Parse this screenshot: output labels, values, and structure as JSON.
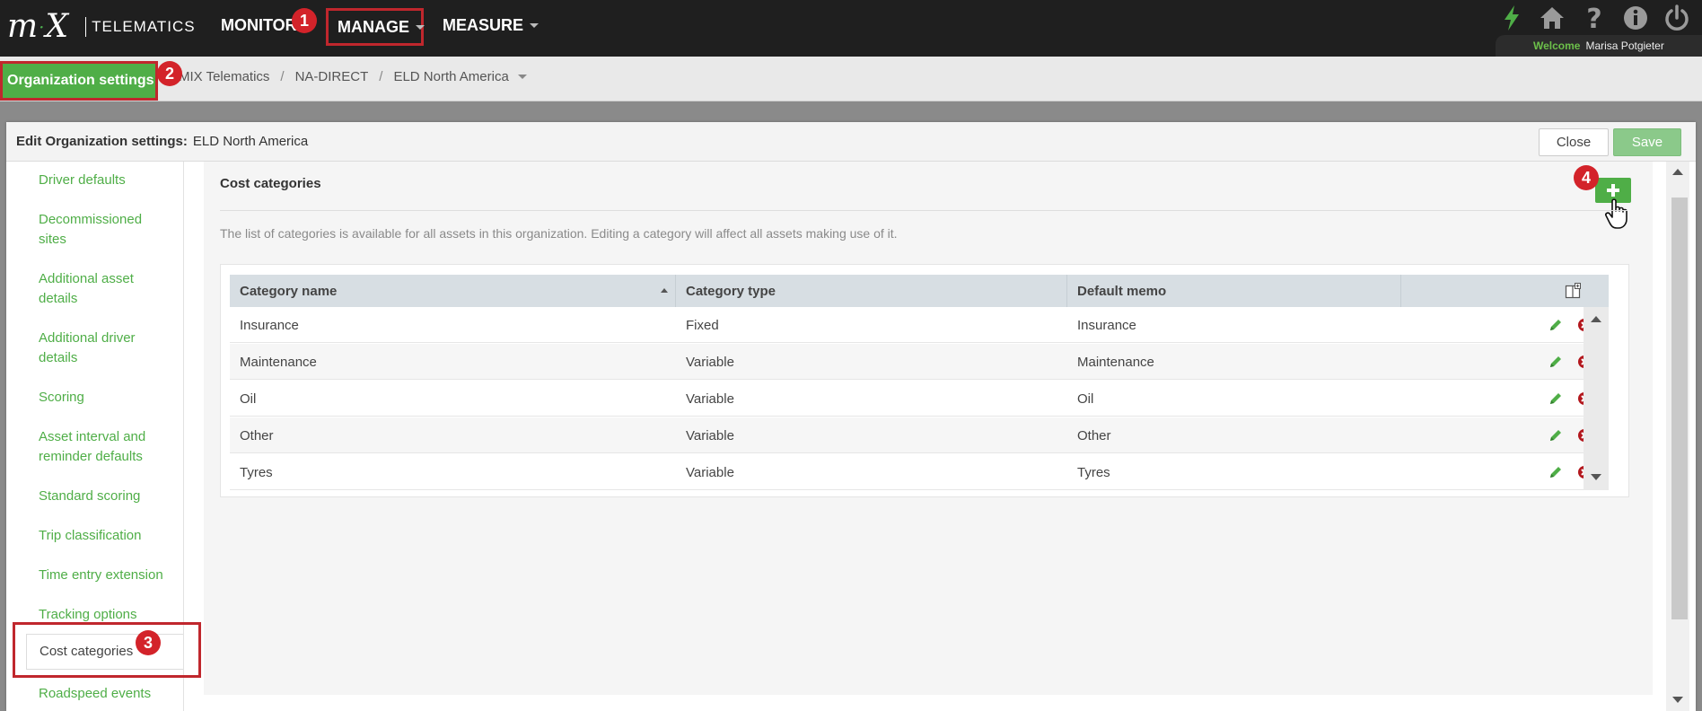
{
  "header": {
    "logo_text": "TELEMATICS",
    "nav": {
      "monitor": "MONITOR",
      "manage": "MANAGE",
      "measure": "MEASURE"
    },
    "icons": [
      "lightning-icon",
      "home-icon",
      "help-icon",
      "info-icon",
      "power-icon"
    ],
    "welcome_label": "Welcome",
    "user_name": "Marisa Potgieter"
  },
  "breadcrumb": {
    "section": "Organization settings",
    "items": [
      "MIX Telematics",
      "NA-DIRECT",
      "ELD North America"
    ]
  },
  "annotations": [
    "1",
    "2",
    "3",
    "4"
  ],
  "panel": {
    "title_label": "Edit Organization settings:",
    "title_value": "ELD North America",
    "close_label": "Close",
    "save_label": "Save"
  },
  "sidebar": {
    "items": [
      "Driver defaults",
      "Decommissioned sites",
      "Additional asset details",
      "Additional driver details",
      "Scoring",
      "Asset interval and reminder defaults",
      "Standard scoring",
      "Trip classification",
      "Time entry extension",
      "Tracking options",
      "Cost categories",
      "Roadspeed events"
    ],
    "active": "Cost categories"
  },
  "content": {
    "section_title": "Cost categories",
    "description": "The list of categories is available for all assets in this organization. Editing a category will affect all assets making use of it.",
    "table": {
      "columns": [
        "Category name",
        "Category type",
        "Default memo"
      ],
      "rows": [
        [
          "Insurance",
          "Fixed",
          "Insurance"
        ],
        [
          "Maintenance",
          "Variable",
          "Maintenance"
        ],
        [
          "Oil",
          "Variable",
          "Oil"
        ],
        [
          "Other",
          "Variable",
          "Other"
        ],
        [
          "Tyres",
          "Variable",
          "Tyres"
        ]
      ]
    }
  },
  "colors": {
    "accent_green": "#4fae47",
    "highlight_red": "#c0272d",
    "badge_red": "#d3232a",
    "topbar_bg": "#1f1f1f"
  }
}
